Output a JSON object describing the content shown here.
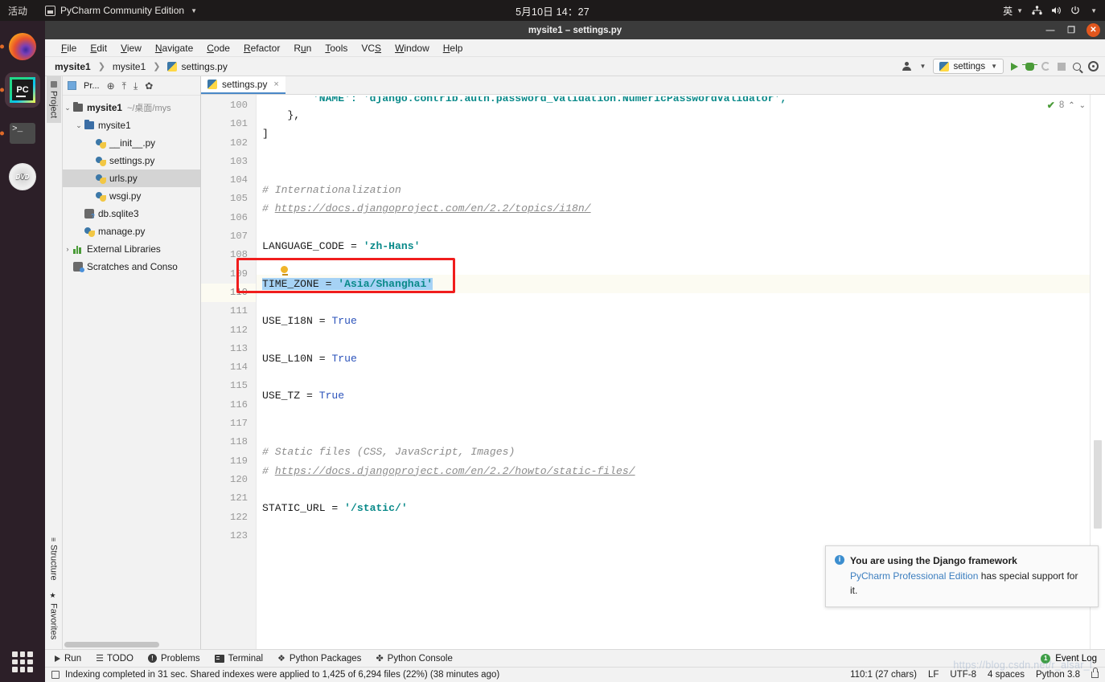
{
  "desktop": {
    "activities": "活动",
    "app_name": "PyCharm Community Edition",
    "clock": "5月10日 14：27",
    "input_method": "英",
    "dock": [
      {
        "name": "firefox",
        "label": "Firefox"
      },
      {
        "name": "pycharm",
        "label": "PyCharm"
      },
      {
        "name": "terminal",
        "label": "Terminal"
      },
      {
        "name": "dvd",
        "label": "DVD"
      }
    ]
  },
  "window": {
    "title": "mysite1 – settings.py",
    "minimize": "—",
    "maximize": "❐",
    "close": "✕"
  },
  "menu": [
    {
      "label": "File",
      "accel": "F"
    },
    {
      "label": "Edit",
      "accel": "E"
    },
    {
      "label": "View",
      "accel": "V"
    },
    {
      "label": "Navigate",
      "accel": "N"
    },
    {
      "label": "Code",
      "accel": "C"
    },
    {
      "label": "Refactor",
      "accel": "R"
    },
    {
      "label": "Run",
      "accel": "u"
    },
    {
      "label": "Tools",
      "accel": "T"
    },
    {
      "label": "VCS",
      "accel": "S"
    },
    {
      "label": "Window",
      "accel": "W"
    },
    {
      "label": "Help",
      "accel": "H"
    }
  ],
  "breadcrumb": {
    "project": "mysite1",
    "package": "mysite1",
    "file": "settings.py"
  },
  "toolbar": {
    "run_config": "settings",
    "run_title": "Run",
    "debug_title": "Debug",
    "rerun_title": "Run with Coverage",
    "stop_title": "Stop",
    "search_title": "Search Everywhere",
    "settings_title": "Settings"
  },
  "tool_windows": {
    "left_tabs": [
      {
        "label": "Project",
        "selected": true
      },
      {
        "label": "Structure",
        "selected": false
      },
      {
        "label": "Favorites",
        "selected": false
      }
    ]
  },
  "project_pane": {
    "header_label": "Pr...",
    "tree": [
      {
        "depth": 0,
        "arrow": "⌄",
        "icon": "folder",
        "label": "mysite1",
        "bold": true,
        "path": "~/桌面/mys",
        "selected": false
      },
      {
        "depth": 1,
        "arrow": "⌄",
        "icon": "folder-blue",
        "label": "mysite1",
        "bold": false,
        "path": "",
        "selected": false
      },
      {
        "depth": 2,
        "arrow": "",
        "icon": "python-file",
        "label": "__init__.py",
        "bold": false,
        "path": "",
        "selected": false
      },
      {
        "depth": 2,
        "arrow": "",
        "icon": "python-file",
        "label": "settings.py",
        "bold": false,
        "path": "",
        "selected": false
      },
      {
        "depth": 2,
        "arrow": "",
        "icon": "python-file",
        "label": "urls.py",
        "bold": false,
        "path": "",
        "selected": true
      },
      {
        "depth": 2,
        "arrow": "",
        "icon": "python-file",
        "label": "wsgi.py",
        "bold": false,
        "path": "",
        "selected": false
      },
      {
        "depth": 1,
        "arrow": "",
        "icon": "db-file",
        "label": "db.sqlite3",
        "bold": false,
        "path": "",
        "selected": false
      },
      {
        "depth": 1,
        "arrow": "",
        "icon": "python-file",
        "label": "manage.py",
        "bold": false,
        "path": "",
        "selected": false
      },
      {
        "depth": 0,
        "arrow": "›",
        "icon": "library",
        "label": "External Libraries",
        "bold": false,
        "path": "",
        "selected": false
      },
      {
        "depth": 0,
        "arrow": "",
        "icon": "scratch",
        "label": "Scratches and Conso",
        "bold": false,
        "path": "",
        "selected": false
      }
    ]
  },
  "editor": {
    "tab_label": "settings.py",
    "tab_close": "×",
    "first_line": 100,
    "inspection": {
      "count": "8",
      "up": "⌃",
      "down": "⌄"
    },
    "lines": [
      {
        "n": 100,
        "fold": "none",
        "segments": [
          {
            "t": "txt",
            "s": "        'NAME': 'django.contrib.auth.password_validation.NumericPasswordValidator',"
          }
        ],
        "clipped": true
      },
      {
        "n": 101,
        "fold": "end",
        "segments": [
          {
            "t": "txt",
            "s": "    },"
          }
        ]
      },
      {
        "n": 102,
        "fold": "end",
        "segments": [
          {
            "t": "txt",
            "s": "]"
          }
        ]
      },
      {
        "n": 103,
        "fold": "none",
        "segments": []
      },
      {
        "n": 104,
        "fold": "none",
        "segments": []
      },
      {
        "n": 105,
        "fold": "start",
        "segments": [
          {
            "t": "cmt",
            "s": "# Internationalization"
          }
        ]
      },
      {
        "n": 106,
        "fold": "end",
        "segments": [
          {
            "t": "cmt",
            "s": "# "
          },
          {
            "t": "link",
            "s": "https://docs.djangoproject.com/en/2.2/topics/i18n/"
          }
        ]
      },
      {
        "n": 107,
        "fold": "none",
        "segments": []
      },
      {
        "n": 108,
        "fold": "none",
        "segments": [
          {
            "t": "txt",
            "s": "LANGUAGE_CODE = "
          },
          {
            "t": "str",
            "s": "'zh-Hans'"
          }
        ]
      },
      {
        "n": 109,
        "fold": "none",
        "segments": [],
        "bulb": true
      },
      {
        "n": 110,
        "fold": "none",
        "current": true,
        "segments": [
          {
            "t": "sel",
            "s": "TIME_ZONE = "
          },
          {
            "t": "sel-str",
            "s": "'Asia/Shanghai'"
          }
        ]
      },
      {
        "n": 111,
        "fold": "none",
        "segments": []
      },
      {
        "n": 112,
        "fold": "none",
        "segments": [
          {
            "t": "txt",
            "s": "USE_I18N = "
          },
          {
            "t": "kw",
            "s": "True"
          }
        ]
      },
      {
        "n": 113,
        "fold": "none",
        "segments": []
      },
      {
        "n": 114,
        "fold": "none",
        "segments": [
          {
            "t": "txt",
            "s": "USE_L10N = "
          },
          {
            "t": "kw",
            "s": "True"
          }
        ]
      },
      {
        "n": 115,
        "fold": "none",
        "segments": []
      },
      {
        "n": 116,
        "fold": "none",
        "segments": [
          {
            "t": "txt",
            "s": "USE_TZ = "
          },
          {
            "t": "kw",
            "s": "True"
          }
        ]
      },
      {
        "n": 117,
        "fold": "none",
        "segments": []
      },
      {
        "n": 118,
        "fold": "none",
        "segments": []
      },
      {
        "n": 119,
        "fold": "start",
        "segments": [
          {
            "t": "cmt",
            "s": "# Static files (CSS, JavaScript, Images)"
          }
        ]
      },
      {
        "n": 120,
        "fold": "end",
        "segments": [
          {
            "t": "cmt",
            "s": "# "
          },
          {
            "t": "link",
            "s": "https://docs.djangoproject.com/en/2.2/howto/static-files/"
          }
        ]
      },
      {
        "n": 121,
        "fold": "none",
        "segments": []
      },
      {
        "n": 122,
        "fold": "none",
        "segments": [
          {
            "t": "txt",
            "s": "STATIC_URL = "
          },
          {
            "t": "str",
            "s": "'/static/'"
          }
        ]
      },
      {
        "n": 123,
        "fold": "none",
        "segments": []
      }
    ]
  },
  "notification": {
    "title": "You are using the Django framework",
    "link": "PyCharm Professional Edition",
    "body_rest": " has special support for it."
  },
  "bottom_tools": [
    {
      "label": "Run",
      "icon": "run-icon"
    },
    {
      "label": "TODO",
      "icon": "todo-icon"
    },
    {
      "label": "Problems",
      "icon": "problems-icon"
    },
    {
      "label": "Terminal",
      "icon": "terminal-icon"
    },
    {
      "label": "Python Packages",
      "icon": "packages-icon"
    },
    {
      "label": "Python Console",
      "icon": "console-icon"
    }
  ],
  "event_log": {
    "label": "Event Log",
    "badge": "1"
  },
  "status": {
    "message": "Indexing completed in 31 sec. Shared indexes were applied to 1,425 of 6,294 files (22%) (38 minutes ago)",
    "caret": "110:1 (27 chars)",
    "line_ending": "LF",
    "encoding": "UTF-8",
    "indent": "4 spaces",
    "interpreter": "Python 3.8"
  },
  "watermark": "https://blog.csdn.net/r_alsar_l",
  "colors": {
    "accent": "#4a88c7",
    "string": "#0a8a8a",
    "keyword": "#2d54bb",
    "comment": "#8c8c8c",
    "selection": "#a6d2f5",
    "highlight_box": "#f01d1d",
    "current_line": "#fcfbf2"
  }
}
